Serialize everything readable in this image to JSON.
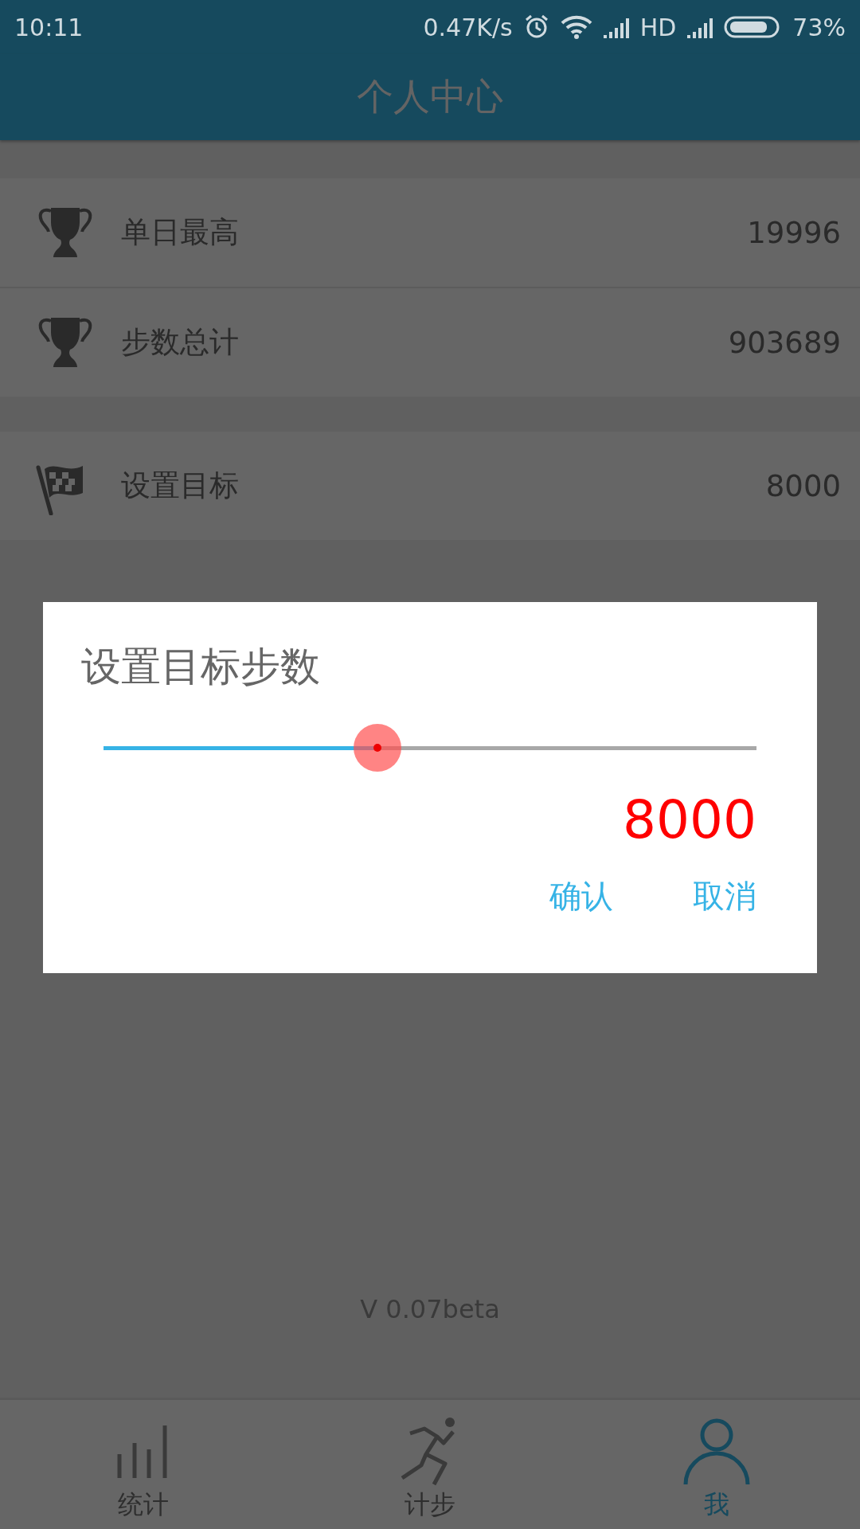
{
  "status_bar": {
    "time": "10:11",
    "net_speed": "0.47K/s",
    "network": "HD",
    "battery": "73%"
  },
  "header": {
    "title": "个人中心"
  },
  "records": [
    {
      "kind": "trophy",
      "label": "单日最高",
      "value": "19996"
    },
    {
      "kind": "trophy",
      "label": "步数总计",
      "value": "903689"
    }
  ],
  "goal": [
    {
      "kind": "flag",
      "label": "设置目标",
      "value": "8000"
    }
  ],
  "version": "V 0.07beta",
  "dialog": {
    "title": "设置目标步数",
    "slider": {
      "level": 0.42
    },
    "value": "8000",
    "buttons": [
      {
        "label": "确认"
      },
      {
        "label": "取消"
      }
    ]
  },
  "nav": [
    {
      "kind": "chart",
      "label": "统计",
      "selected": false
    },
    {
      "kind": "runner",
      "label": "计步",
      "selected": false
    },
    {
      "kind": "person",
      "label": "我",
      "selected": true
    }
  ]
}
